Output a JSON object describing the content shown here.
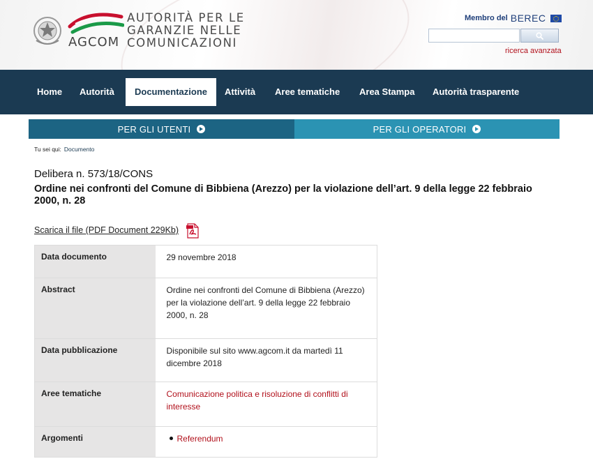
{
  "header": {
    "brand_short": "AGCOM",
    "brand_long": "AUTORITÀ PER LE\nGARANZIE NELLE\nCOMUNICAZIONI",
    "berec_label": "Membro del",
    "berec_logo": "BEREC",
    "search_placeholder": "",
    "advanced_search": "ricerca avanzata",
    "colors": {
      "accent_red": "#b1101b",
      "nav_bg": "#1b3a52"
    }
  },
  "nav": {
    "items": [
      {
        "label": "Home"
      },
      {
        "label": "Autorità"
      },
      {
        "label": "Documentazione",
        "active": true
      },
      {
        "label": "Attività"
      },
      {
        "label": "Aree tematiche"
      },
      {
        "label": "Area Stampa"
      },
      {
        "label": "Autorità trasparente"
      }
    ]
  },
  "user_bars": {
    "users": "PER GLI UTENTI",
    "operators": "PER GLI OPERATORI",
    "colors": {
      "users": "#1c6483",
      "operators": "#2b93b3"
    }
  },
  "breadcrumb": {
    "prefix": "Tu sei qui:",
    "current": "Documento"
  },
  "document": {
    "number": "Delibera n. 573/18/CONS",
    "title": "Ordine nei confronti del Comune di Bibbiena (Arezzo) per la violazione dell’art. 9 della legge 22 febbraio 2000, n. 28",
    "download_label": "Scarica il file (PDF Document 229Kb)",
    "download_icon": "pdf-icon"
  },
  "details": {
    "rows": [
      {
        "label": "Data documento",
        "value": "29 novembre 2018"
      },
      {
        "label": "Abstract",
        "value": "Ordine nei confronti del Comune di Bibbiena (Arezzo) per la violazione dell’art. 9 della legge 22 febbraio 2000, n. 28"
      },
      {
        "label": "Data pubblicazione",
        "value": "Disponibile sul sito www.agcom.it da martedì 11 dicembre 2018"
      },
      {
        "label": "Aree tematiche",
        "value": "Comunicazione politica e risoluzione di conflitti di interesse"
      },
      {
        "label": "Argomenti",
        "value": "Referendum"
      }
    ]
  }
}
